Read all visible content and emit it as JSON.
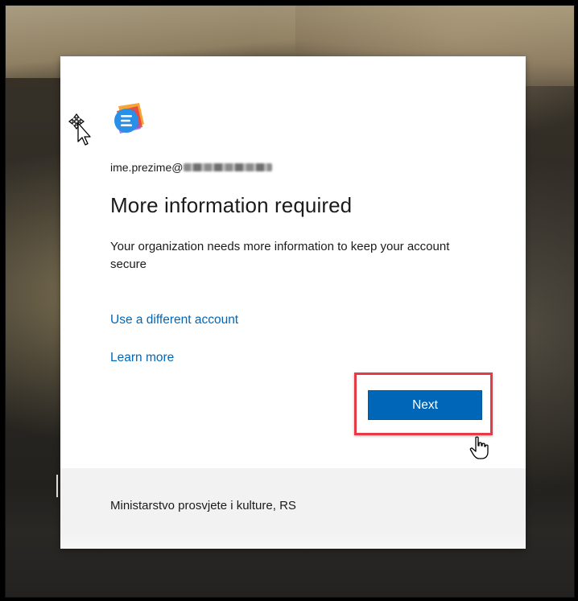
{
  "dialog": {
    "email_prefix": "ime.prezime@",
    "title": "More information required",
    "description": "Your organization needs more information to keep your account secure",
    "use_different_account": "Use a different account",
    "learn_more": "Learn more",
    "next_label": "Next",
    "footer": "Ministarstvo prosvjete i kulture, RS"
  },
  "icons": {
    "logo": "app-logo-icon",
    "move_cursor": "move-cursor-icon",
    "hand_cursor": "hand-pointer-icon"
  },
  "colors": {
    "accent": "#0067b8",
    "highlight": "#e53b46",
    "footer_bg": "#f2f2f2"
  }
}
